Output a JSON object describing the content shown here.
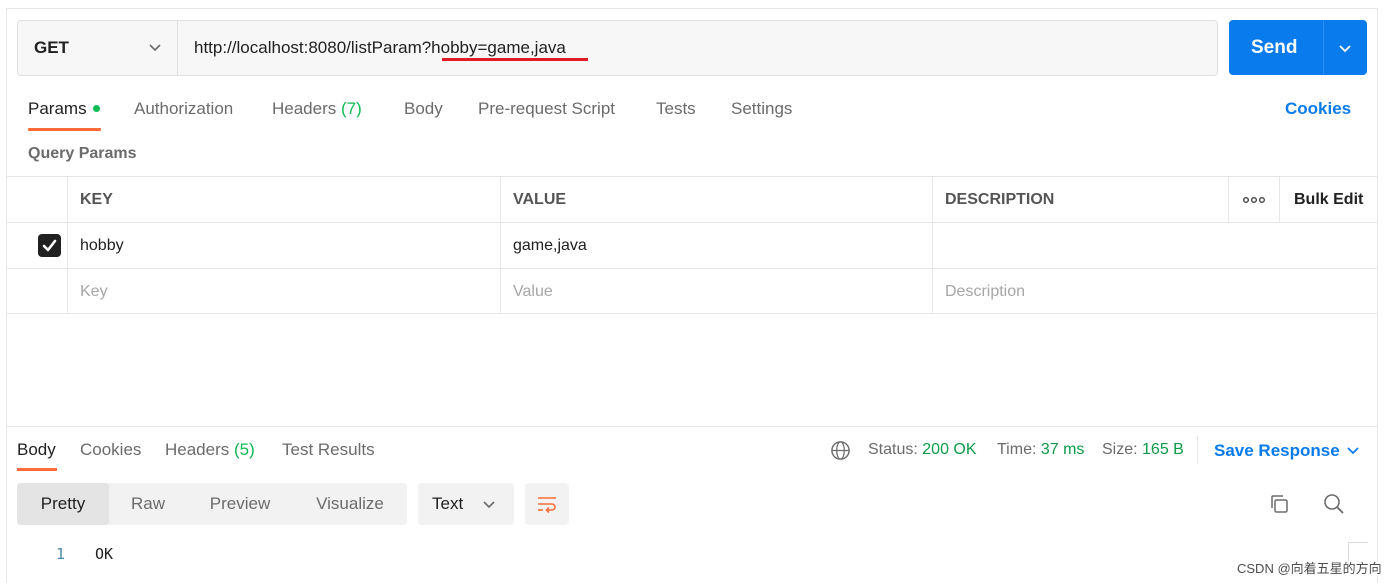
{
  "request": {
    "method": "GET",
    "url": "http://localhost:8080/listParam?hobby=game,java",
    "send_label": "Send"
  },
  "request_tabs": [
    {
      "label": "Params",
      "count": ""
    },
    {
      "label": "Authorization",
      "count": ""
    },
    {
      "label": "Headers",
      "count": "(7)"
    },
    {
      "label": "Body",
      "count": ""
    },
    {
      "label": "Pre-request Script",
      "count": ""
    },
    {
      "label": "Tests",
      "count": ""
    },
    {
      "label": "Settings",
      "count": ""
    }
  ],
  "cookies_label": "Cookies",
  "query_params": {
    "title": "Query Params",
    "headers": {
      "key": "KEY",
      "value": "VALUE",
      "description": "DESCRIPTION",
      "more": "ooo",
      "bulk_edit": "Bulk Edit"
    },
    "rows": [
      {
        "checked": true,
        "key": "hobby",
        "value": "game,java",
        "description": ""
      }
    ],
    "placeholder": {
      "key": "Key",
      "value": "Value",
      "description": "Description"
    }
  },
  "response": {
    "tabs": [
      {
        "label": "Body",
        "count": ""
      },
      {
        "label": "Cookies",
        "count": ""
      },
      {
        "label": "Headers",
        "count": "(5)"
      },
      {
        "label": "Test Results",
        "count": ""
      }
    ],
    "status_label": "Status:",
    "status_value": "200 OK",
    "time_label": "Time:",
    "time_value": "37 ms",
    "size_label": "Size:",
    "size_value": "165 B",
    "save_label": "Save Response",
    "view_modes": [
      "Pretty",
      "Raw",
      "Preview",
      "Visualize"
    ],
    "selected_view": "Pretty",
    "format": "Text",
    "body_lines": [
      {
        "no": "1",
        "text": "OK"
      }
    ]
  },
  "watermark": "CSDN @向着五星的方向",
  "colors": {
    "accent": "#097bed",
    "active_tab": "#ff6c37",
    "success": "#0cbb52",
    "annotation": "#e01b24"
  }
}
